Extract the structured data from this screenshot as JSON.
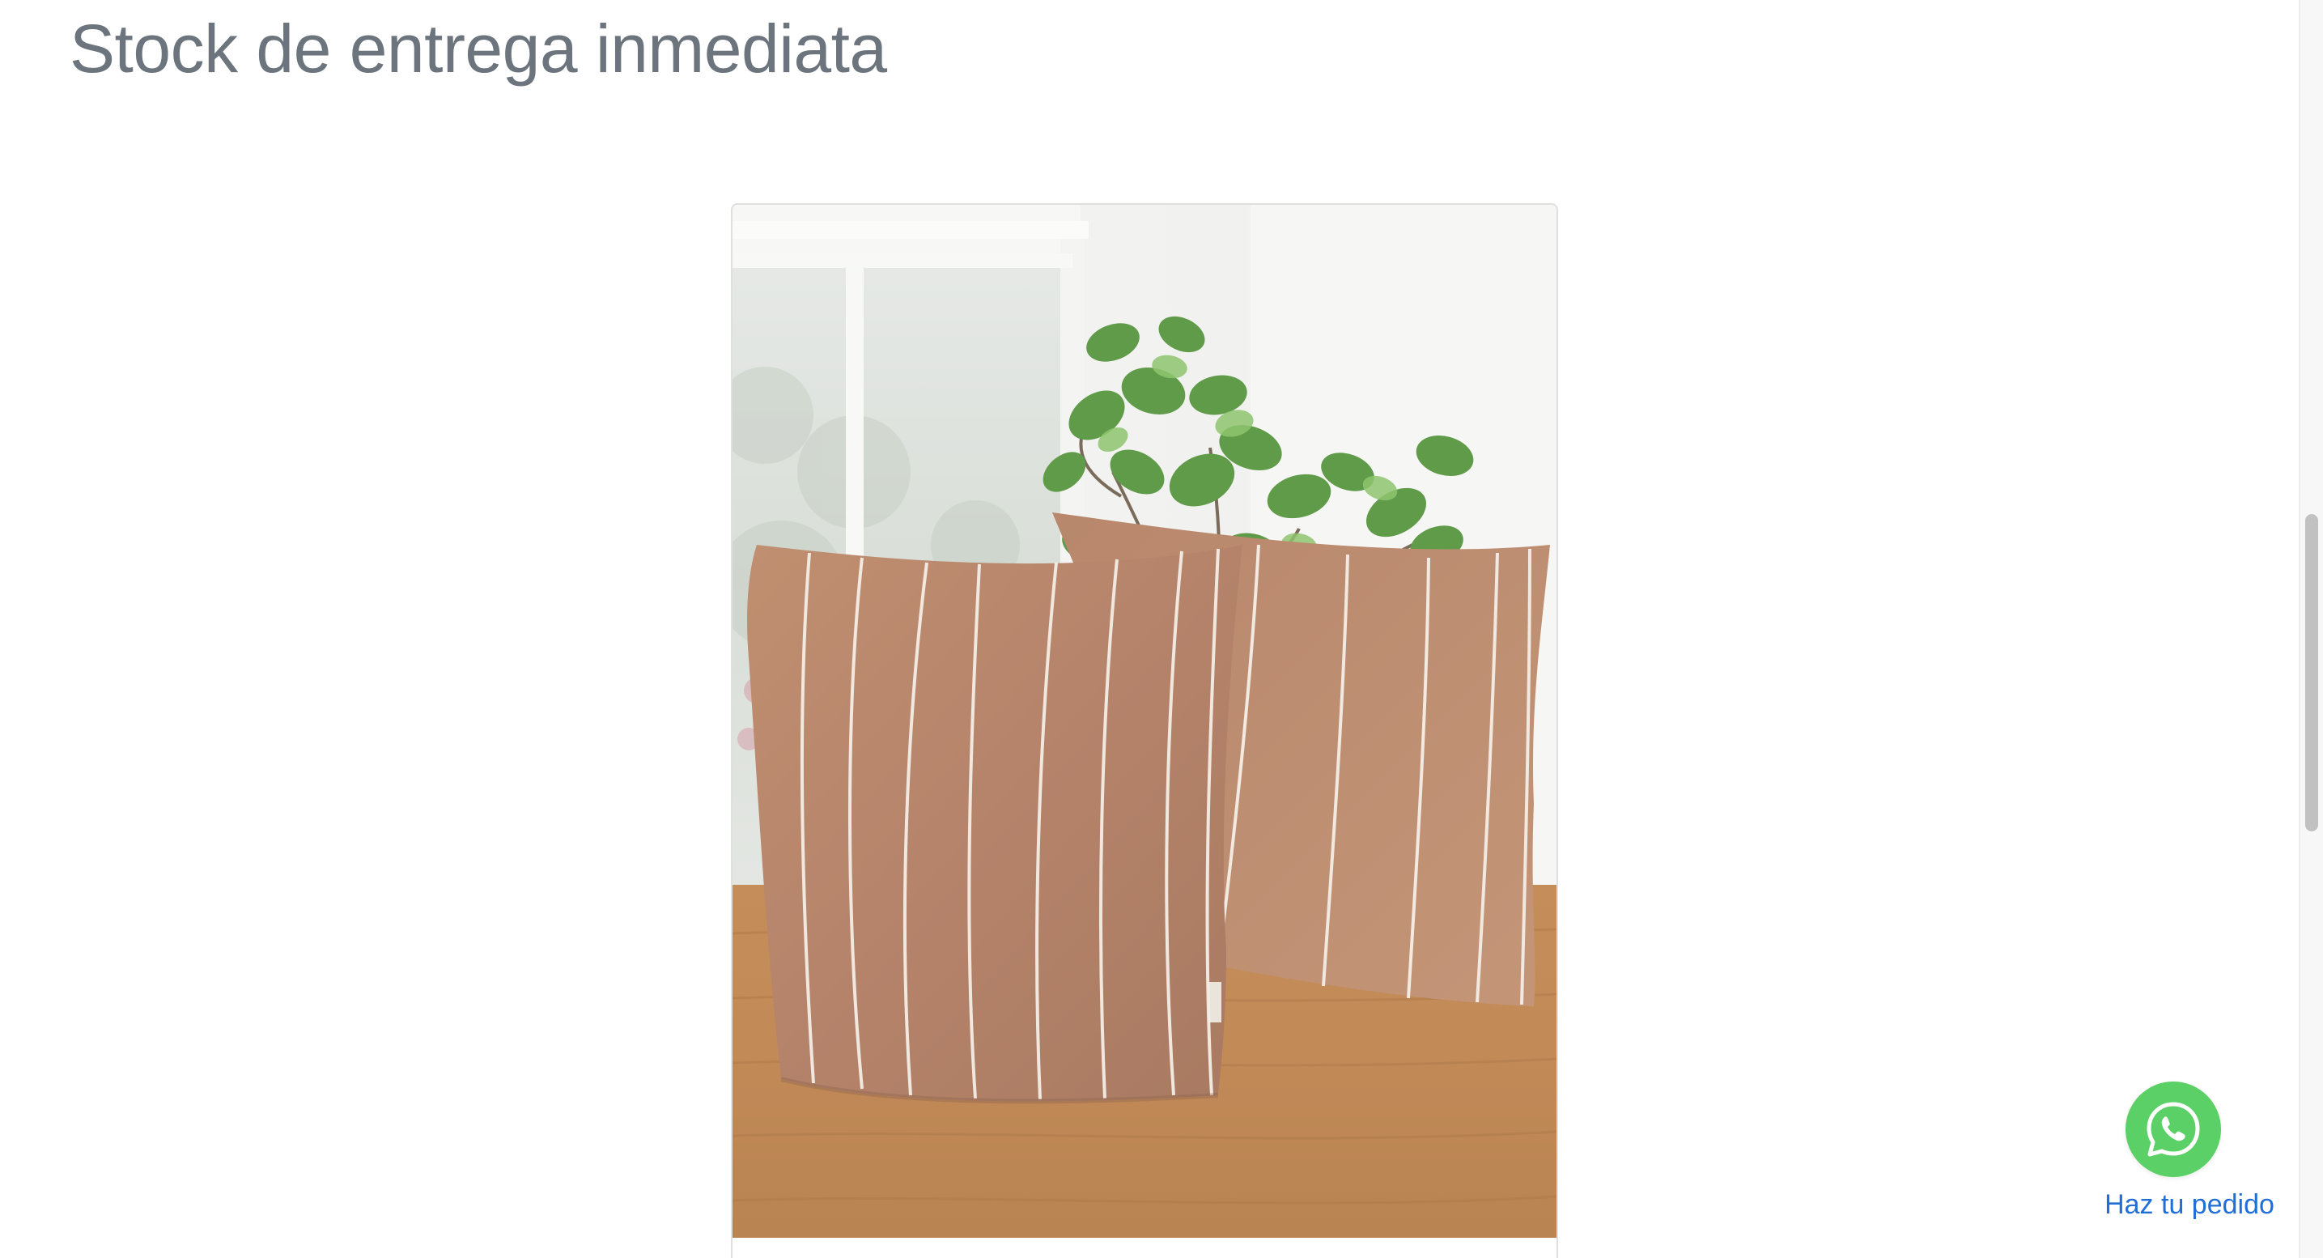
{
  "section": {
    "title": "Stock de entrega inmediata"
  },
  "product_card": {
    "image_subject": "two striped cushions on a wooden table with a plant"
  },
  "whatsapp": {
    "icon": "whatsapp-icon",
    "label": "Haz tu pedido",
    "color": "#5bd066",
    "label_color": "#1f6fd6"
  },
  "colors": {
    "title": "#6c757d",
    "background": "#ffffff",
    "card_border": "#dfdfdf"
  }
}
